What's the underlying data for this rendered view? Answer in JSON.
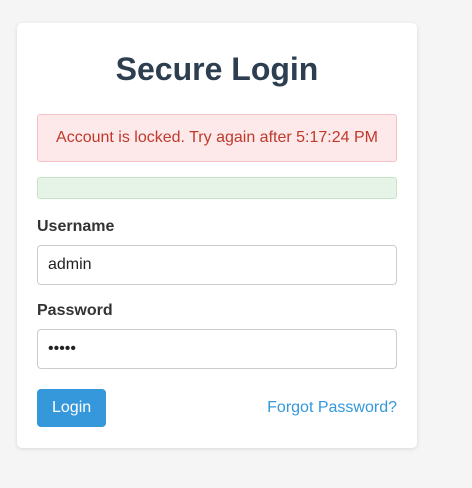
{
  "login": {
    "title": "Secure Login",
    "error_message": "Account is locked. Try again after 5:17:24 PM",
    "success_message": "",
    "username_label": "Username",
    "username_value": "admin",
    "password_label": "Password",
    "password_value": "12345",
    "login_button": "Login",
    "forgot_link": "Forgot Password?"
  },
  "colors": {
    "primary": "#3498db",
    "title": "#2c3e50",
    "error_text": "#c0392b",
    "error_bg": "#fde8ea",
    "success_bg": "#e6f4e7",
    "page_bg": "#f5f5f5"
  }
}
